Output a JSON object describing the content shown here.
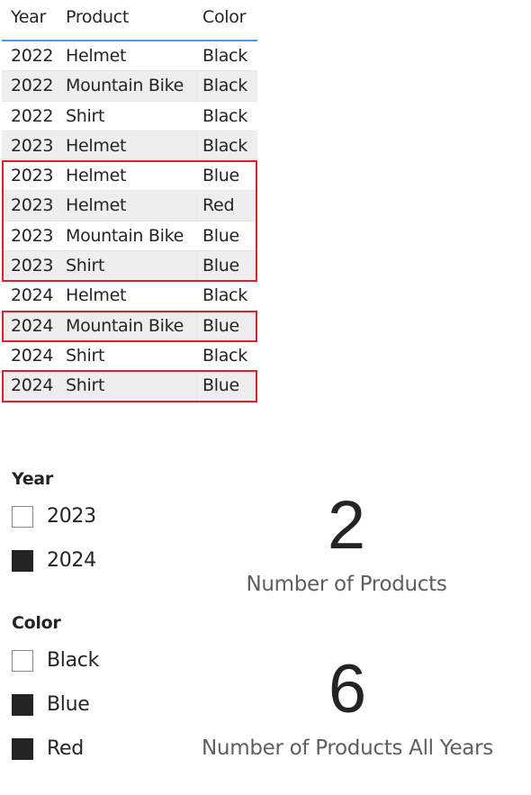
{
  "table": {
    "columns": [
      "Year",
      "Product",
      "Color"
    ],
    "rows": [
      {
        "year": "2022",
        "product": "Helmet",
        "color": "Black",
        "highlighted": false
      },
      {
        "year": "2022",
        "product": "Mountain Bike",
        "color": "Black",
        "highlighted": false
      },
      {
        "year": "2022",
        "product": "Shirt",
        "color": "Black",
        "highlighted": false
      },
      {
        "year": "2023",
        "product": "Helmet",
        "color": "Black",
        "highlighted": false
      },
      {
        "year": "2023",
        "product": "Helmet",
        "color": "Blue",
        "highlighted": true
      },
      {
        "year": "2023",
        "product": "Helmet",
        "color": "Red",
        "highlighted": true
      },
      {
        "year": "2023",
        "product": "Mountain Bike",
        "color": "Blue",
        "highlighted": true
      },
      {
        "year": "2023",
        "product": "Shirt",
        "color": "Blue",
        "highlighted": true
      },
      {
        "year": "2024",
        "product": "Helmet",
        "color": "Black",
        "highlighted": false
      },
      {
        "year": "2024",
        "product": "Mountain Bike",
        "color": "Blue",
        "highlighted": true
      },
      {
        "year": "2024",
        "product": "Shirt",
        "color": "Black",
        "highlighted": false
      },
      {
        "year": "2024",
        "product": "Shirt",
        "color": "Blue",
        "highlighted": true
      }
    ],
    "highlight_color": "#d9232a",
    "header_underline_color": "#4a9fe0"
  },
  "slicers": {
    "year": {
      "title": "Year",
      "items": [
        {
          "label": "2023",
          "checked": false
        },
        {
          "label": "2024",
          "checked": true
        }
      ]
    },
    "color": {
      "title": "Color",
      "items": [
        {
          "label": "Black",
          "checked": false
        },
        {
          "label": "Blue",
          "checked": true
        },
        {
          "label": "Red",
          "checked": true
        }
      ]
    }
  },
  "cards": [
    {
      "value": "2",
      "label": "Number of Products"
    },
    {
      "value": "6",
      "label": "Number of Products All Years"
    }
  ]
}
